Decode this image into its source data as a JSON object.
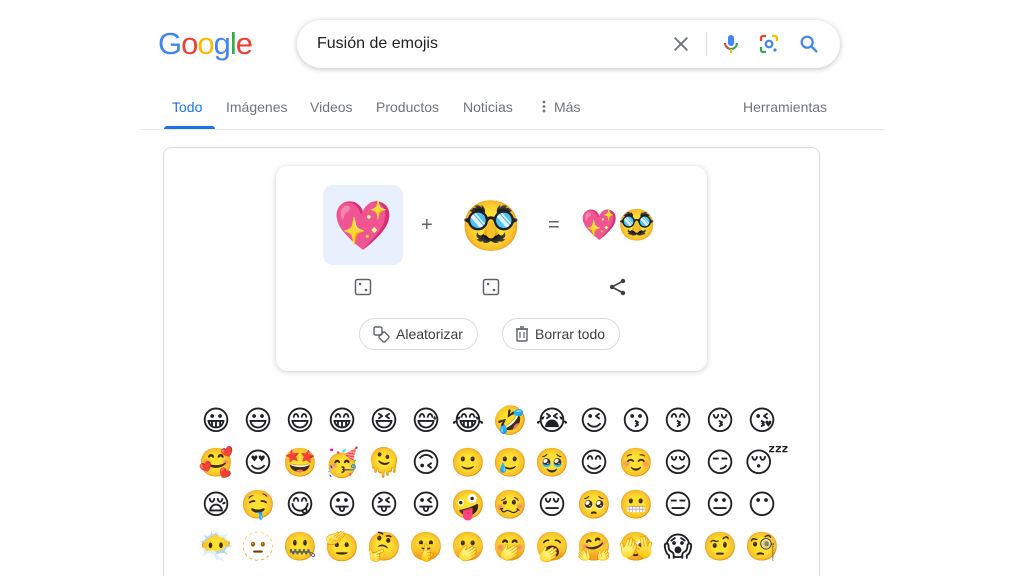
{
  "logo": {
    "letters": [
      "G",
      "o",
      "o",
      "g",
      "l",
      "e"
    ],
    "colors": [
      "#4285F4",
      "#EA4335",
      "#FBBC05",
      "#4285F4",
      "#34A853",
      "#EA4335"
    ]
  },
  "search": {
    "query": "Fusión de emojis"
  },
  "tabs": [
    {
      "label": "Todo",
      "active": true
    },
    {
      "label": "Imágenes"
    },
    {
      "label": "Videos"
    },
    {
      "label": "Productos"
    },
    {
      "label": "Noticias"
    },
    {
      "label": "Más"
    }
  ],
  "tools_label": "Herramientas",
  "mixer": {
    "left_emoji": "💖",
    "plus": "+",
    "right_emoji": "🥸",
    "equals": "=",
    "result_emoji": "💖🥸",
    "randomize_label": "Aleatorizar",
    "clear_label": "Borrar todo"
  },
  "emoji_rows": [
    [
      "😀",
      "😃",
      "😄",
      "😁",
      "😆",
      "😅",
      "😂",
      "🤣",
      "😭",
      "😉",
      "😗",
      "😙",
      "😚",
      "😘"
    ],
    [
      "🥰",
      "😍",
      "🤩",
      "🥳",
      "🫠",
      "🙃",
      "🙂",
      "🥲",
      "🥹",
      "😊",
      "☺️",
      "😌",
      "😏",
      "😴"
    ],
    [
      "😪",
      "🤤",
      "😋",
      "😛",
      "😝",
      "😜",
      "🤪",
      "🥴",
      "😔",
      "🥺",
      "😬",
      "😑",
      "😐",
      "😶"
    ],
    [
      "😶‍🌫️",
      "🫥",
      "🤐",
      "🫡",
      "🤔",
      "🤫",
      "🫢",
      "🤭",
      "🥱",
      "🤗",
      "🫣",
      "😱",
      "🤨",
      "🧐"
    ]
  ]
}
